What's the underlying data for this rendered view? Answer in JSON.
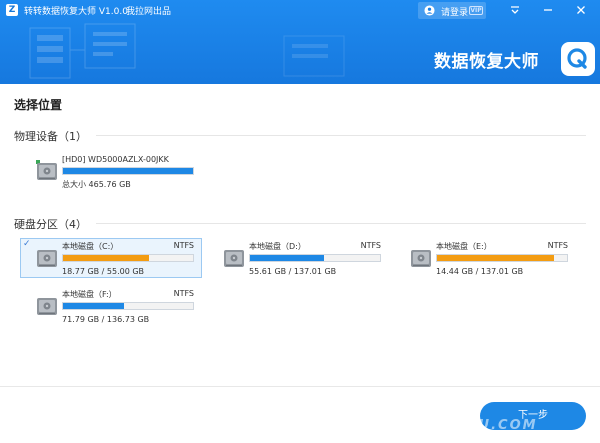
{
  "app": {
    "logo_letter": "Z",
    "title": "转转数据恢复大师 V1.0.0",
    "subtitle": "我拉网出品",
    "login_label": "请登录",
    "vip_label": "VIP",
    "brand": "数据恢复大师",
    "accent_color": "#1e88e5"
  },
  "page": {
    "title": "选择位置"
  },
  "physical": {
    "section_label": "物理设备（1）",
    "devices": [
      {
        "name": "[HD0] WD5000AZLX-00JKK",
        "size": "总大小 465.76 GB",
        "used_fraction": 1.0,
        "icon": "hard-disk-icon"
      }
    ]
  },
  "partitions": {
    "section_label": "硬盘分区（4）",
    "items": [
      {
        "name": "本地磁盘（C:）",
        "fs": "NTFS",
        "size": "18.77 GB / 55.00 GB",
        "used_fraction": 0.66,
        "color": "#f39c12",
        "selected": true
      },
      {
        "name": "本地磁盘（D:）",
        "fs": "NTFS",
        "size": "55.61 GB / 137.01 GB",
        "used_fraction": 0.57,
        "color": "#1e88e5",
        "selected": false
      },
      {
        "name": "本地磁盘（E:）",
        "fs": "NTFS",
        "size": "14.44 GB / 137.01 GB",
        "used_fraction": 0.9,
        "color": "#f39c12",
        "selected": false
      },
      {
        "name": "本地磁盘（F:）",
        "fs": "NTFS",
        "size": "71.79 GB / 136.73 GB",
        "used_fraction": 0.47,
        "color": "#1e88e5",
        "selected": false
      }
    ]
  },
  "footer": {
    "next_label": "下一步",
    "watermark": "ASPKU.COM"
  }
}
